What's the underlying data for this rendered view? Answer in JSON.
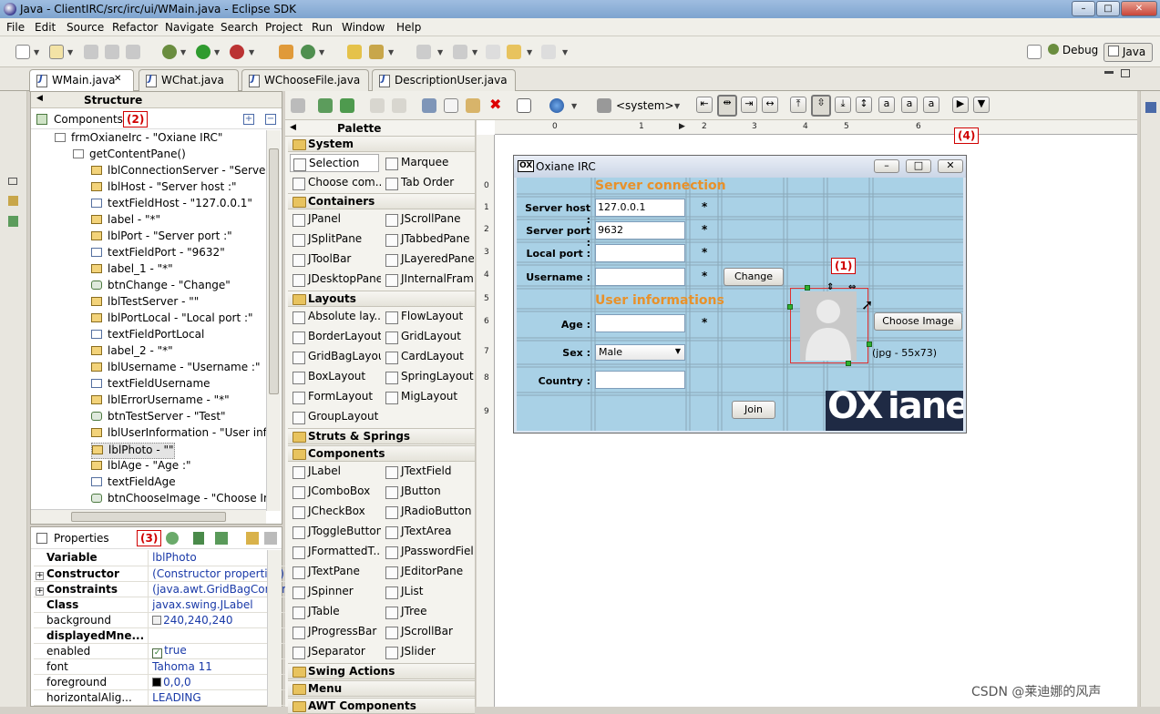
{
  "window": {
    "title": "Java - ClientIRC/src/irc/ui/WMain.java - Eclipse SDK",
    "minimize": "–",
    "maximize": "□",
    "close": "✕"
  },
  "menu": [
    "File",
    "Edit",
    "Source",
    "Refactor",
    "Navigate",
    "Search",
    "Project",
    "Run",
    "Window",
    "Help"
  ],
  "perspectives": {
    "debug": "Debug",
    "java": "Java"
  },
  "editor_tabs": [
    {
      "label": "WMain.java",
      "active": true,
      "close": "✕"
    },
    {
      "label": "WChat.java"
    },
    {
      "label": "WChooseFile.java"
    },
    {
      "label": "DescriptionUser.java"
    }
  ],
  "structure": {
    "title": "Structure",
    "components_label": "Components",
    "annotation": "(2)",
    "tree": [
      "frmOxianeIrc - \"Oxiane IRC\"",
      "getContentPane()",
      "lblConnectionServer - \"Server co",
      "lblHost - \"Server host :\"",
      "textFieldHost - \"127.0.0.1\"",
      "label - \"*\"",
      "lblPort - \"Server port :\"",
      "textFieldPort - \"9632\"",
      "label_1 - \"*\"",
      "btnChange - \"Change\"",
      "lblTestServer - \"\"",
      "lblPortLocal - \"Local port :\"",
      "textFieldPortLocal",
      "label_2 - \"*\"",
      "lblUsername - \"Username :\"",
      "textFieldUsername",
      "lblErrorUsername - \"*\"",
      "btnTestServer - \"Test\"",
      "lblUserInformation - \"User inforn",
      "lblPhoto - \"\"",
      "lblAge - \"Age :\"",
      "textFieldAge",
      "btnChooseImage - \"Choose Imag"
    ]
  },
  "properties": {
    "title": "Properties",
    "annotation": "(3)",
    "rows": [
      {
        "key": "Variable",
        "value": "lblPhoto",
        "bold": true
      },
      {
        "key": "Constructor",
        "value": "(Constructor properties)",
        "bold": true,
        "expand": "+"
      },
      {
        "key": "Constraints",
        "value": "(java.awt.GridBagConstrai...",
        "bold": true,
        "expand": "+"
      },
      {
        "key": "Class",
        "value": "javax.swing.JLabel",
        "bold": true
      },
      {
        "key": "background",
        "value": "240,240,240"
      },
      {
        "key": "displayedMne...",
        "value": "",
        "bold": true
      },
      {
        "key": "enabled",
        "value": "true"
      },
      {
        "key": "font",
        "value": "Tahoma 11"
      },
      {
        "key": "foreground",
        "value": "0,0,0"
      },
      {
        "key": "horizontalAlig...",
        "value": "LEADING"
      }
    ]
  },
  "palette": {
    "title": "Palette",
    "system_dropdown": "<system>",
    "sections": {
      "system": "System",
      "containers": "Containers",
      "layouts": "Layouts",
      "struts": "Struts & Springs",
      "components": "Components",
      "swing_actions": "Swing Actions",
      "menu": "Menu",
      "awt": "AWT Components"
    },
    "system_items": [
      "Selection",
      "Marquee",
      "Choose com...",
      "Tab Order"
    ],
    "container_items": [
      "JPanel",
      "JScrollPane",
      "JSplitPane",
      "JTabbedPane",
      "JToolBar",
      "JLayeredPane",
      "JDesktopPane",
      "JInternalFrame"
    ],
    "layout_items": [
      "Absolute lay...",
      "FlowLayout",
      "BorderLayout",
      "GridLayout",
      "GridBagLayout",
      "CardLayout",
      "BoxLayout",
      "SpringLayout",
      "FormLayout",
      "MigLayout",
      "GroupLayout"
    ],
    "component_items": [
      "JLabel",
      "JTextField",
      "JComboBox",
      "JButton",
      "JCheckBox",
      "JRadioButton",
      "JToggleButton",
      "JTextArea",
      "JFormattedT...",
      "JPasswordField",
      "JTextPane",
      "JEditorPane",
      "JSpinner",
      "JList",
      "JTable",
      "JTree",
      "JProgressBar",
      "JScrollBar",
      "JSeparator",
      "JSlider"
    ]
  },
  "ruler": {
    "cols": [
      "0",
      "1",
      "2",
      "3",
      "4",
      "5",
      "6"
    ],
    "rows": [
      "0",
      "1",
      "2",
      "3",
      "4",
      "5",
      "6",
      "7",
      "8",
      "9"
    ]
  },
  "form": {
    "title": "Oxiane IRC",
    "logo_badge": "OX",
    "section_server": "Server connection",
    "section_user": "User informations",
    "labels": {
      "host": "Server host :",
      "port": "Server port :",
      "local_port": "Local port :",
      "username": "Username :",
      "age": "Age :",
      "sex": "Sex :",
      "country": "Country :"
    },
    "values": {
      "host": "127.0.0.1",
      "port": "9632",
      "local_port": "",
      "username": "",
      "age": "",
      "sex": "Male",
      "country": ""
    },
    "star": "*",
    "buttons": {
      "change": "Change",
      "choose_image": "Choose Image",
      "join": "Join"
    },
    "photo_caption": "(jpg - 55x73)",
    "brand": {
      "ox": "OX",
      "iane": "iane"
    }
  },
  "annotations": {
    "one": "(1)",
    "four": "(4)"
  },
  "watermark": "CSDN @莱迪娜的风声",
  "colors": {
    "form_bg": "#a9d1e6",
    "section_orange": "#e8912a",
    "annotation_red": "#d00000"
  }
}
